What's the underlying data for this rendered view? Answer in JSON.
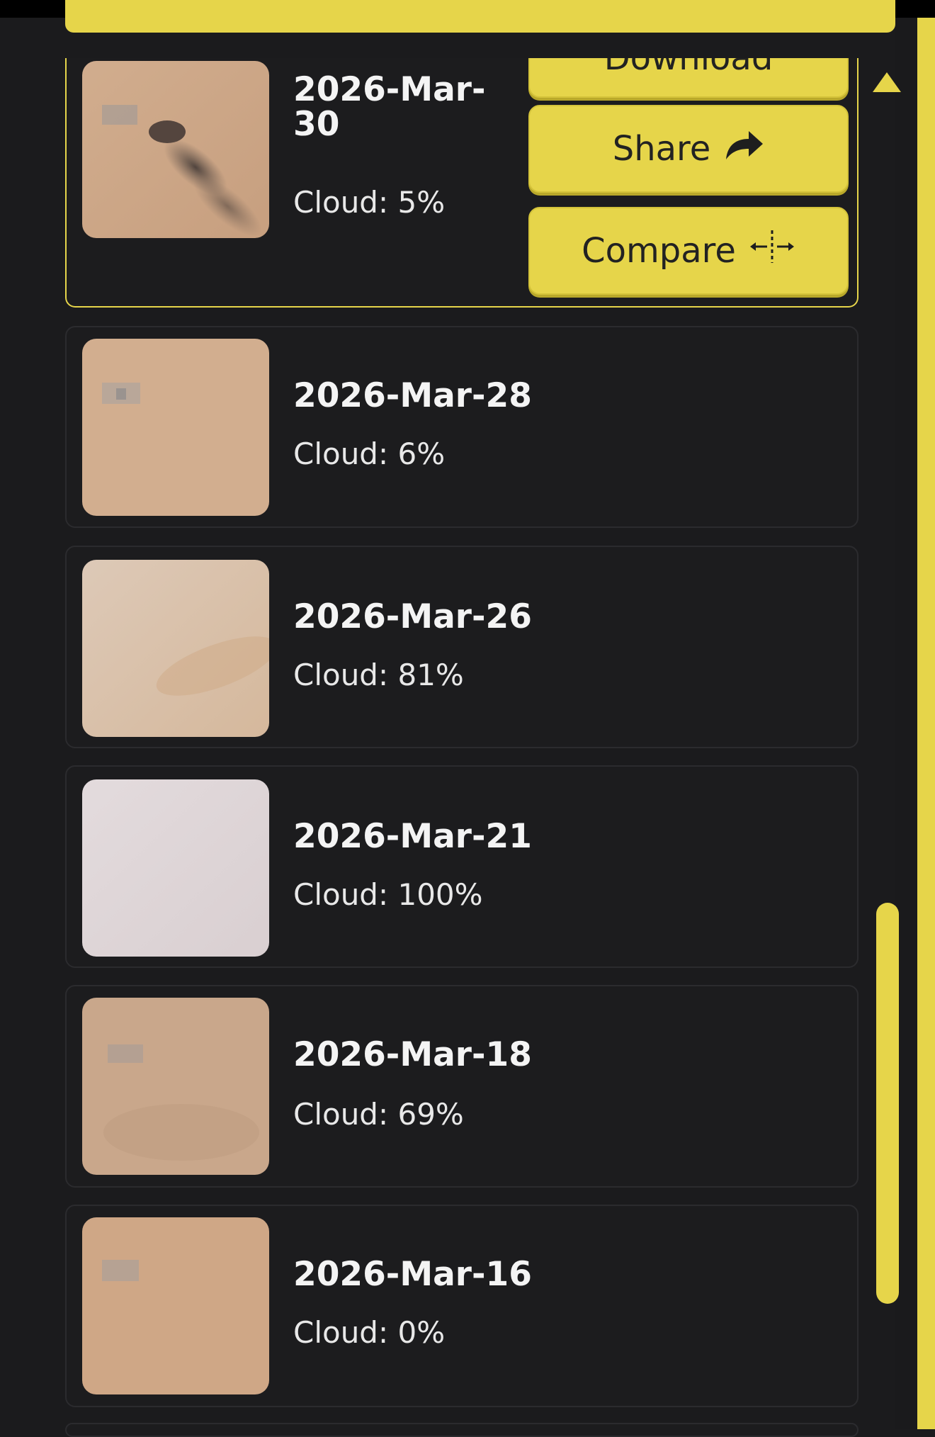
{
  "accent_color": "#e6d54a",
  "background_color": "#1b1b1d",
  "selected_item": {
    "date": "2026-Mar-30",
    "cloud": "Cloud: 5%",
    "actions": {
      "download_label": "Download",
      "share_label": "Share",
      "compare_label": "Compare"
    }
  },
  "items": [
    {
      "date": "2026-Mar-28",
      "cloud": "Cloud: 6%"
    },
    {
      "date": "2026-Mar-26",
      "cloud": "Cloud: 81%"
    },
    {
      "date": "2026-Mar-21",
      "cloud": "Cloud: 100%"
    },
    {
      "date": "2026-Mar-18",
      "cloud": "Cloud: 69%"
    },
    {
      "date": "2026-Mar-16",
      "cloud": "Cloud: 0%"
    }
  ],
  "icons": {
    "share": "share-arrow-icon",
    "compare": "compare-split-icon",
    "scroll_up": "triangle-up-icon"
  }
}
